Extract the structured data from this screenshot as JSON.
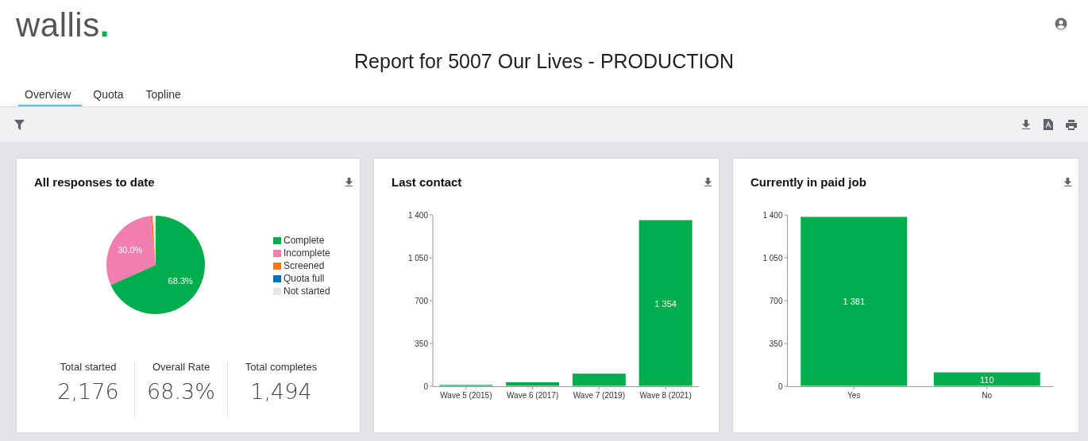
{
  "header": {
    "logo": "wallis",
    "logo_mark": "."
  },
  "title": "Report for 5007 Our Lives - PRODUCTION",
  "tabs": [
    {
      "label": "Overview",
      "selected": true
    },
    {
      "label": "Quota",
      "selected": false
    },
    {
      "label": "Topline",
      "selected": false
    }
  ],
  "cards": [
    {
      "title": "All responses to date",
      "chart_data": {
        "type": "pie",
        "categories": [
          "Complete",
          "Incomplete",
          "Screened",
          "Quota full",
          "Not started"
        ],
        "values": [
          68.3,
          30.0,
          0.7,
          0,
          1.0
        ],
        "colors": [
          "#00ad4d",
          "#f07fb0",
          "#f47920",
          "#0072bc",
          "#e6e6e6"
        ],
        "value_labels": [
          "68.3%",
          "30.0%",
          null,
          null,
          null
        ],
        "legend": "right"
      },
      "stats": [
        {
          "label": "Total started",
          "value": "2,176"
        },
        {
          "label": "Overall Rate",
          "value": "68.3%"
        },
        {
          "label": "Total completes",
          "value": "1,494"
        }
      ]
    },
    {
      "title": "Last contact",
      "chart_data": {
        "type": "bar",
        "categories": [
          "Wave 5 (2015)",
          "Wave 6 (2017)",
          "Wave 7 (2019)",
          "Wave 8 (2021)"
        ],
        "values": [
          8,
          30,
          100,
          1354
        ],
        "ylim": [
          0,
          1400
        ],
        "yticks": [
          0,
          350,
          700,
          1050,
          1400
        ],
        "value_labels": [
          null,
          null,
          null,
          "1 354"
        ]
      }
    },
    {
      "title": "Currently in paid job",
      "chart_data": {
        "type": "bar",
        "categories": [
          "Yes",
          "No"
        ],
        "values": [
          1381,
          110
        ],
        "ylim": [
          0,
          1400
        ],
        "yticks": [
          0,
          350,
          700,
          1050,
          1400
        ],
        "value_labels": [
          "1 381",
          "110"
        ]
      }
    }
  ]
}
